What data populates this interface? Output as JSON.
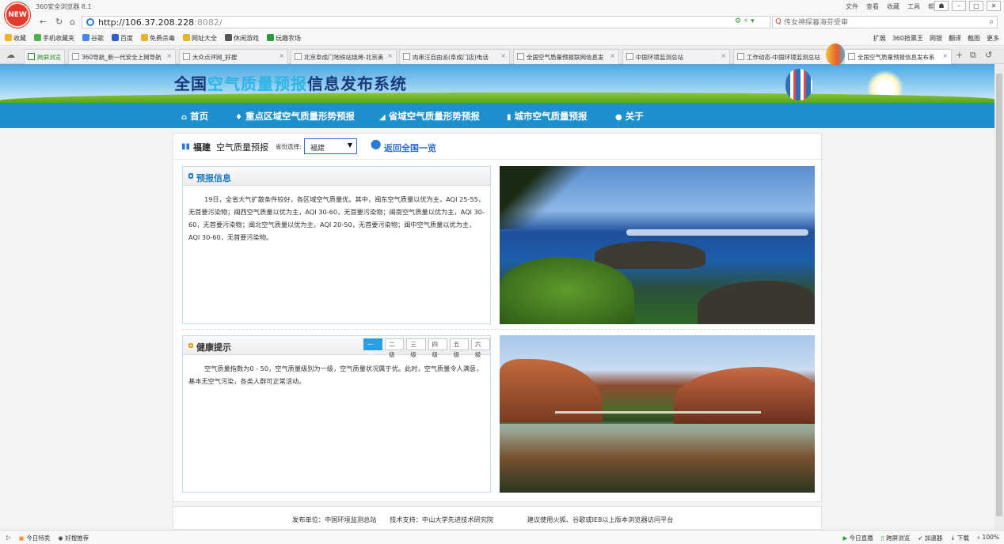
{
  "browser": {
    "app_title": "360安全浏览器 8.1",
    "logo_text": "NEW",
    "title_menu": [
      "文件",
      "查看",
      "收藏",
      "工具",
      "帮助"
    ],
    "url_host": "http://106.37.208.228",
    "url_rest": ":8082/",
    "search_placeholder": "传女神探暮海芬受审",
    "bookmarks_left": [
      "收藏",
      "手机收藏夹",
      "谷歌",
      "百度",
      "免费杀毒",
      "网址大全",
      "休闲游戏",
      "玩趣农场"
    ],
    "bookmarks_right": [
      "扩展",
      "360抢票王",
      "网银",
      "翻译",
      "截图",
      "更多"
    ],
    "tabs": [
      "跨屏浏览",
      "360导航_新一代安全上网导航",
      "大众点评网_好搜",
      "北京阜成门地铁站烧烤-北京美",
      "肉串汪自由派(阜成门店)电话",
      "全国空气质量预报联网信息发",
      "中国环境监测总站",
      "工作动态-中国环境监测总站",
      "全国空气质量预报信息发布系"
    ],
    "status_left": [
      "今日特卖",
      "好搜推荐"
    ],
    "status_right": [
      "今日直播",
      "跨屏浏览",
      "加速器",
      "下载",
      "100%"
    ]
  },
  "site": {
    "title_part1": "全国",
    "title_part2": "空气质量预报",
    "title_part3": "信息发布系统",
    "nav": [
      "首页",
      "重点区域空气质量形势预报",
      "省域空气质量形势预报",
      "城市空气质量预报",
      "关于"
    ]
  },
  "province": {
    "name": "福建",
    "subtitle": "空气质量预报",
    "select_label": "省份选择:",
    "selected": "福建",
    "back_link": "返回全国一览"
  },
  "forecast": {
    "title": "预报信息",
    "body": "19日，全省大气扩散条件较好，各区域空气质量优。其中，闽东空气质量以优为主，AQI 25-55，无首要污染物；闽西空气质量以优为主，AQI 30-60，无首要污染物；闽南空气质量以优为主，AQI 30-60，无首要污染物；闽北空气质量以优为主，AQI 20-50，无首要污染物；闽中空气质量以优为主，AQI 30-60，无首要污染物。"
  },
  "health": {
    "title": "健康提示",
    "levels": [
      "一级",
      "二级",
      "三级",
      "四级",
      "五级",
      "六级"
    ],
    "active_level": "一级",
    "body": "空气质量指数为0 - 50，空气质量级别为一级，空气质量状况属于优。此时，空气质量令人满意，基本无空气污染，各类人群可正常活动。"
  },
  "footer": {
    "publisher": "发布单位：中国环境监测总站",
    "support": "技术支持：中山大学先进技术研究院",
    "browser_note": "建议使用火狐、谷歌或IE8以上版本浏览器访问平台"
  },
  "colors": {
    "nav_bg": "#1e8fcd",
    "accent_blue": "#2b6ecf",
    "title_highlight": "#2fb5e3",
    "level_active": "#2b9ee3"
  }
}
